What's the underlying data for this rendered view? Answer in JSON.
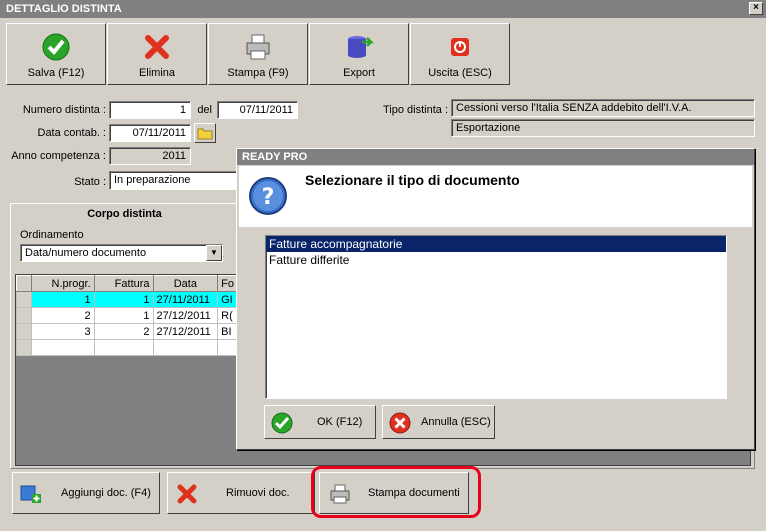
{
  "window": {
    "title": "DETTAGLIO DISTINTA",
    "close": "×"
  },
  "toolbar": {
    "save": "Salva (F12)",
    "delete": "Elimina",
    "print": "Stampa (F9)",
    "export": "Export",
    "exit": "Uscita (ESC)"
  },
  "form": {
    "numero_label": "Numero distinta :",
    "numero_value": "1",
    "del_label": "del",
    "del_value": "07/11/2011",
    "data_label": "Data contab. :",
    "data_value": "07/11/2011",
    "anno_label": "Anno competenza :",
    "anno_value": "2011",
    "stato_label": "Stato :",
    "stato_value": "In preparazione",
    "tipo_label": "Tipo distinta :",
    "tipo_value1": "Cessioni verso l'Italia SENZA addebito dell'I.V.A.",
    "tipo_value2": "Esportazione"
  },
  "corpo": {
    "title": "Corpo distinta",
    "ordinamento_label": "Ordinamento",
    "ordinamento_value": "Data/numero documento",
    "headers": [
      "N.progr.",
      "Fattura",
      "Data",
      "Fo"
    ],
    "rows": [
      [
        "1",
        "1",
        "27/11/2011",
        "GI"
      ],
      [
        "2",
        "1",
        "27/12/2011",
        "R("
      ],
      [
        "3",
        "2",
        "27/12/2011",
        "BI"
      ]
    ]
  },
  "bottom": {
    "add": "Aggiungi doc. (F4)",
    "remove": "Rimuovi doc.",
    "print_docs": "Stampa documenti"
  },
  "dialog": {
    "title": "READY PRO",
    "question": "Selezionare il tipo di documento",
    "options": [
      "Fatture accompagnatorie",
      "Fatture differite"
    ],
    "ok": "OK (F12)",
    "cancel": "Annulla (ESC)"
  },
  "colors": {
    "selection": "#0a246a",
    "row_highlight": "#00ffff",
    "callout": "#e8001c"
  }
}
